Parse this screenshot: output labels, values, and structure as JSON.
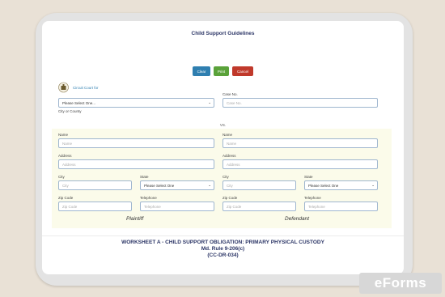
{
  "form": {
    "title": "Child Support Guidelines",
    "buttons": {
      "clear": "Clear",
      "print": "Print",
      "cancel": "Cancel"
    },
    "court": {
      "label": "Circuit Court for",
      "select_value": "Please Select One...",
      "city_county": "City or County"
    },
    "case_no": {
      "label": "Case No.",
      "placeholder": "Case No."
    },
    "vs": "VS.",
    "plaintiff": {
      "caption": "Plaintiff",
      "name": {
        "label": "Name",
        "placeholder": "Name"
      },
      "address": {
        "label": "Address",
        "placeholder": "Address"
      },
      "city": {
        "label": "City",
        "placeholder": "City"
      },
      "state": {
        "label": "State",
        "value": "Please Select One"
      },
      "zip": {
        "label": "Zip Code",
        "placeholder": "Zip Code"
      },
      "phone": {
        "label": "Telephone",
        "placeholder": "Telephone"
      }
    },
    "defendant": {
      "caption": "Defendant",
      "name": {
        "label": "Name",
        "placeholder": "Name"
      },
      "address": {
        "label": "Address",
        "placeholder": "Address"
      },
      "city": {
        "label": "City",
        "placeholder": "City"
      },
      "state": {
        "label": "State",
        "value": "Please Select One"
      },
      "zip": {
        "label": "Zip Code",
        "placeholder": "Zip Code"
      },
      "phone": {
        "label": "Telephone",
        "placeholder": "Telephone"
      }
    },
    "worksheet": {
      "line1": "WORKSHEET A - CHILD SUPPORT OBLIGATION: PRIMARY PHYSICAL CUSTODY",
      "line2": "Md. Rule 9-206(c)",
      "line3": "(CC-DR-034)"
    }
  },
  "watermark": "eForms",
  "colors": {
    "accent": "#2f7fb0",
    "clear": "#2f7fb0",
    "print": "#5aa23a",
    "cancel": "#c0392b",
    "title": "#2b3566"
  }
}
